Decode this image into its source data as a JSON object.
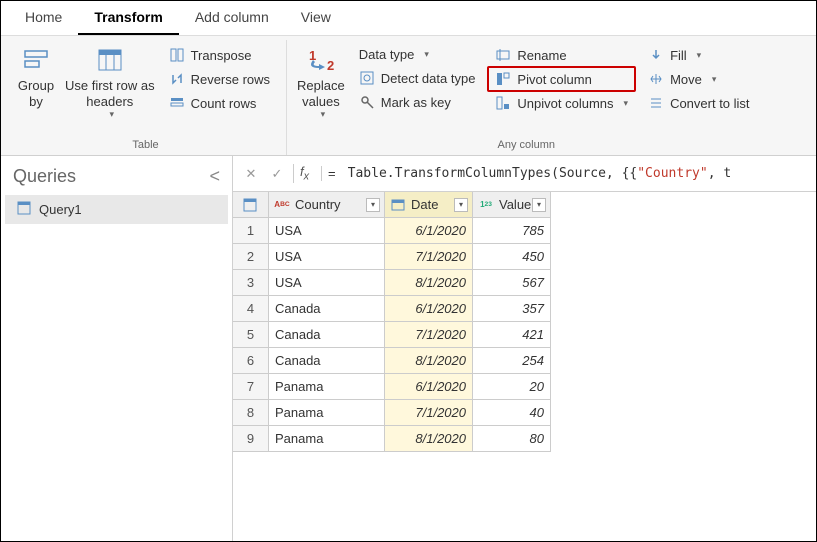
{
  "tabs": [
    "Home",
    "Transform",
    "Add column",
    "View"
  ],
  "active_tab": 1,
  "ribbon": {
    "group_table": {
      "title": "Table",
      "group_by": "Group\nby",
      "first_row": "Use first row as\nheaders",
      "transpose": "Transpose",
      "reverse_rows": "Reverse rows",
      "count_rows": "Count rows"
    },
    "group_any": {
      "title": "Any column",
      "replace_values": "Replace\nvalues",
      "data_type": "Data type",
      "detect": "Detect data type",
      "mark_key": "Mark as key",
      "rename": "Rename",
      "pivot": "Pivot column",
      "unpivot": "Unpivot columns",
      "fill": "Fill",
      "move": "Move",
      "convert": "Convert to list"
    }
  },
  "sidebar": {
    "title": "Queries",
    "items": [
      "Query1"
    ]
  },
  "formula": {
    "prefix": "Table.TransformColumnTypes(Source, {{",
    "string": "\"Country\"",
    "suffix": ", t"
  },
  "columns": [
    {
      "key": "country",
      "label": "Country",
      "type": "ABC"
    },
    {
      "key": "date",
      "label": "Date",
      "type": "cal"
    },
    {
      "key": "value",
      "label": "Value",
      "type": "123"
    }
  ],
  "rows": [
    {
      "country": "USA",
      "date": "6/1/2020",
      "value": "785"
    },
    {
      "country": "USA",
      "date": "7/1/2020",
      "value": "450"
    },
    {
      "country": "USA",
      "date": "8/1/2020",
      "value": "567"
    },
    {
      "country": "Canada",
      "date": "6/1/2020",
      "value": "357"
    },
    {
      "country": "Canada",
      "date": "7/1/2020",
      "value": "421"
    },
    {
      "country": "Canada",
      "date": "8/1/2020",
      "value": "254"
    },
    {
      "country": "Panama",
      "date": "6/1/2020",
      "value": "20"
    },
    {
      "country": "Panama",
      "date": "7/1/2020",
      "value": "40"
    },
    {
      "country": "Panama",
      "date": "8/1/2020",
      "value": "80"
    }
  ]
}
